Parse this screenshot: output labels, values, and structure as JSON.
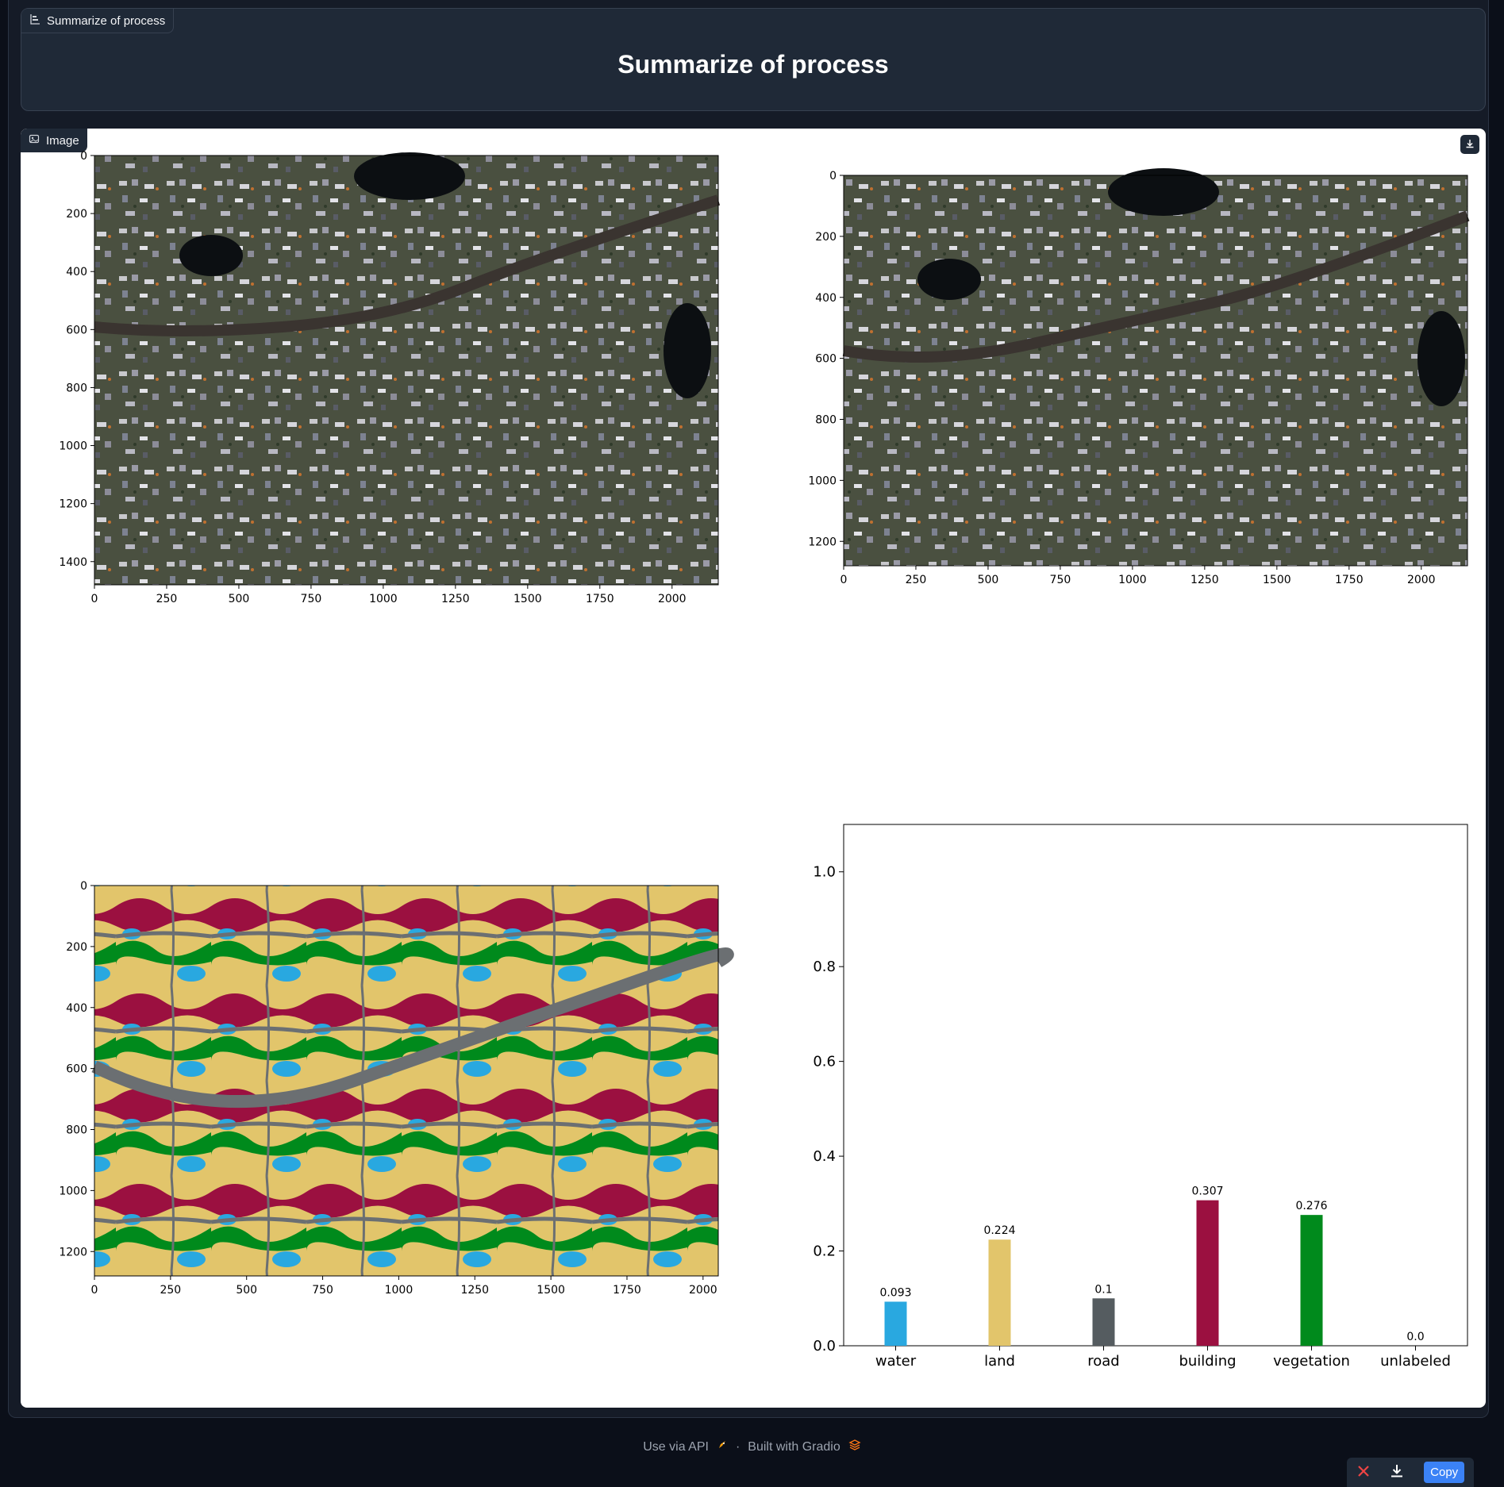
{
  "title_block": {
    "chip_label": "Summarize of process",
    "heading": "Summarize of process"
  },
  "image_block": {
    "chip_label": "Image"
  },
  "plots": {
    "top_left": {
      "x_ticks": [
        "0",
        "250",
        "500",
        "750",
        "1000",
        "1250",
        "1500",
        "1750",
        "2000"
      ],
      "y_ticks": [
        "0",
        "200",
        "400",
        "600",
        "800",
        "1000",
        "1200",
        "1400"
      ]
    },
    "top_right": {
      "x_ticks": [
        "0",
        "250",
        "500",
        "750",
        "1000",
        "1250",
        "1500",
        "1750",
        "2000"
      ],
      "y_ticks": [
        "0",
        "200",
        "400",
        "600",
        "800",
        "1000",
        "1200"
      ]
    },
    "bottom_left": {
      "x_ticks": [
        "0",
        "250",
        "500",
        "750",
        "1000",
        "1250",
        "1500",
        "1750",
        "2000"
      ],
      "y_ticks": [
        "0",
        "200",
        "400",
        "600",
        "800",
        "1000",
        "1200"
      ]
    }
  },
  "chart_data": {
    "type": "bar",
    "categories": [
      "water",
      "land",
      "road",
      "building",
      "vegetation",
      "unlabeled"
    ],
    "values": [
      0.093,
      0.224,
      0.1,
      0.307,
      0.276,
      0.0
    ],
    "value_labels": [
      "0.093",
      "0.224",
      "0.1",
      "0.307",
      "0.276",
      "0.0"
    ],
    "colors": [
      "#29a8e0",
      "#e2c56b",
      "#555c60",
      "#9b1040",
      "#008a1c",
      "#ffffff"
    ],
    "ylim": [
      0,
      1.1
    ],
    "y_ticks": [
      "0.0",
      "0.2",
      "0.4",
      "0.6",
      "0.8",
      "1.0"
    ],
    "title": "",
    "xlabel": "",
    "ylabel": ""
  },
  "footer": {
    "api_label": "Use via API",
    "separator": "·",
    "built_label": "Built with Gradio"
  },
  "toolbar": {
    "copy_label": "Copy"
  }
}
